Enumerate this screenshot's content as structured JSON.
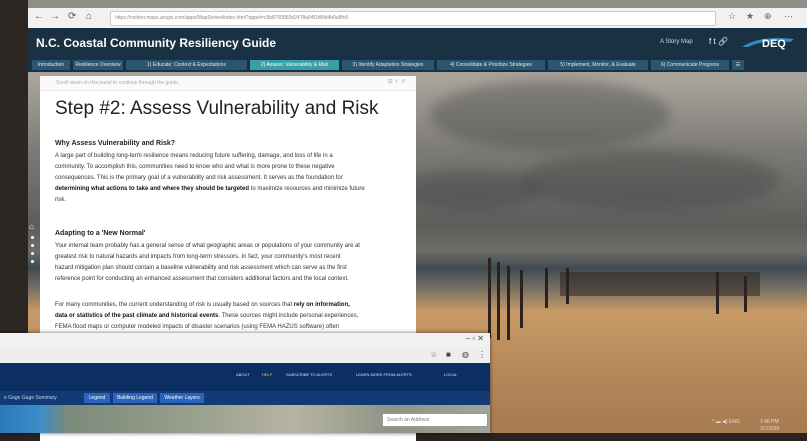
{
  "browser": {
    "nav_icons": [
      "←",
      "→",
      "⟳",
      "⌂"
    ],
    "url": "https://ncdenr.maps.arcgis.com/apps/MapSeries/index.html?appid=c9b8700850d2478a94f2d0fd4b0a8fc8",
    "right_icons": [
      "☆",
      "★",
      "⊕",
      "⋯"
    ]
  },
  "app": {
    "title": "N.C. Coastal Community Resiliency Guide",
    "story_map_label": "A Story Map",
    "header_icons": [
      "f",
      "t",
      "🔗"
    ],
    "logo_text": "DEQ"
  },
  "tabs": [
    {
      "label": "Introduction",
      "active": false
    },
    {
      "label": "Resilience Overview",
      "active": false
    },
    {
      "label": "1) Educate: Context & Expectations",
      "active": false
    },
    {
      "label": "2) Assess: Vulnerability & Risk",
      "active": true
    },
    {
      "label": "3) Identify Adaptation Strategies",
      "active": false
    },
    {
      "label": "4) Consolidate & Prioritize Strategies",
      "active": false
    },
    {
      "label": "5) Implement, Monitor, & Evaluate",
      "active": false
    },
    {
      "label": "6) Communicate Progress",
      "active": false
    },
    {
      "label": "☰",
      "active": false
    }
  ],
  "panel": {
    "header_text": "Scroll down on this panel to continue through the guide.",
    "header_icons": "⊟ ✓ ✐",
    "heading": "Step #2: Assess Vulnerability and Risk",
    "section1_title": "Why Assess Vulnerability and Risk?",
    "section1_l1": "A large part of building long-term resilience means reducing future suffering, damage, and loss of life in a",
    "section1_l2": "community. To accomplish this, communities need to know who and what is more prone to these negative",
    "section1_l3": "consequences. This is the primary goal of a vulnerability and risk assessment. It serves as the foundation for",
    "section1_l4a": "determining what actions to take and where they should be targeted",
    "section1_l4b": " to maximize resources and minimize future",
    "section1_l5": "risk.",
    "section2_title": "Adapting to a 'New Normal'",
    "section2_l1": "Your internal team probably has a general sense of what geographic areas or populations of your community are at",
    "section2_l2": "greatest risk to natural hazards and impacts from long-term stressors. In fact, your community's most recent",
    "section2_l3": "hazard mitigation plan should contain a baseline vulnerability and risk assessment which can serve as the first",
    "section2_l4": "reference point for conducting an enhanced assessment that considers additional factors and the local context.",
    "section3_l1a": "For many communities, the current understanding of risk is usually based on sources that ",
    "section3_l1b": "rely on information,",
    "section3_l2a": "data or statistics of the past climate and historical events",
    "section3_l2b": ". These sources might include personal experiences,",
    "section3_l3": "FEMA flood maps or computer modeled impacts of disaster scenarios (using FEMA HAZUS software) often"
  },
  "window2": {
    "controls": "–  ▫  ✕",
    "bar_icons": [
      "☆",
      "■",
      "◍",
      "⋮"
    ],
    "nav_links": [
      "ABOUT",
      "HELP",
      "SUBSCRIBE TO ALERTS",
      "LEARN MORE FROM ALERTS",
      "LOCAL"
    ],
    "sub_text": "e Gage   Gage Summary",
    "sub_tabs": [
      "Legend",
      "Building Legend",
      "Weather Layers"
    ],
    "search_placeholder": "Search an Address"
  },
  "tray": {
    "icons": "^ ▬ ◀)  ENG",
    "time": "1:46 PM",
    "date": "3/7/2020"
  }
}
